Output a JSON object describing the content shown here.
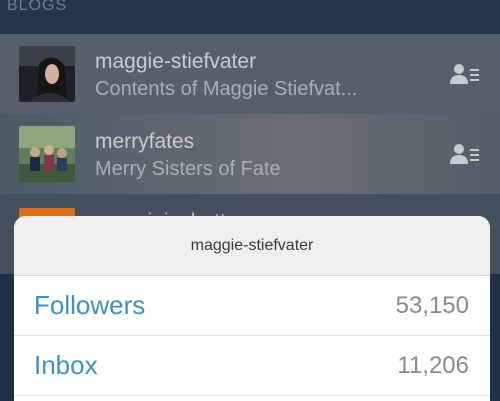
{
  "section": {
    "title": "BLOGS"
  },
  "blogs": [
    {
      "name": "maggie-stiefvater",
      "title": "Contents of Maggie Stiefvat..."
    },
    {
      "name": "merryfates",
      "title": "Merry Sisters of Fate"
    },
    {
      "name": "maggieisahattoo"
    }
  ],
  "sheet": {
    "title": "maggie-stiefvater",
    "items": [
      {
        "label": "Followers",
        "count": "53,150"
      },
      {
        "label": "Inbox",
        "count": "11,206"
      }
    ]
  },
  "colors": {
    "accent": "#3f8fc8",
    "background": "#1f2f44",
    "row_highlight": "#56606c"
  },
  "icons": [
    "follow-list-icon"
  ]
}
